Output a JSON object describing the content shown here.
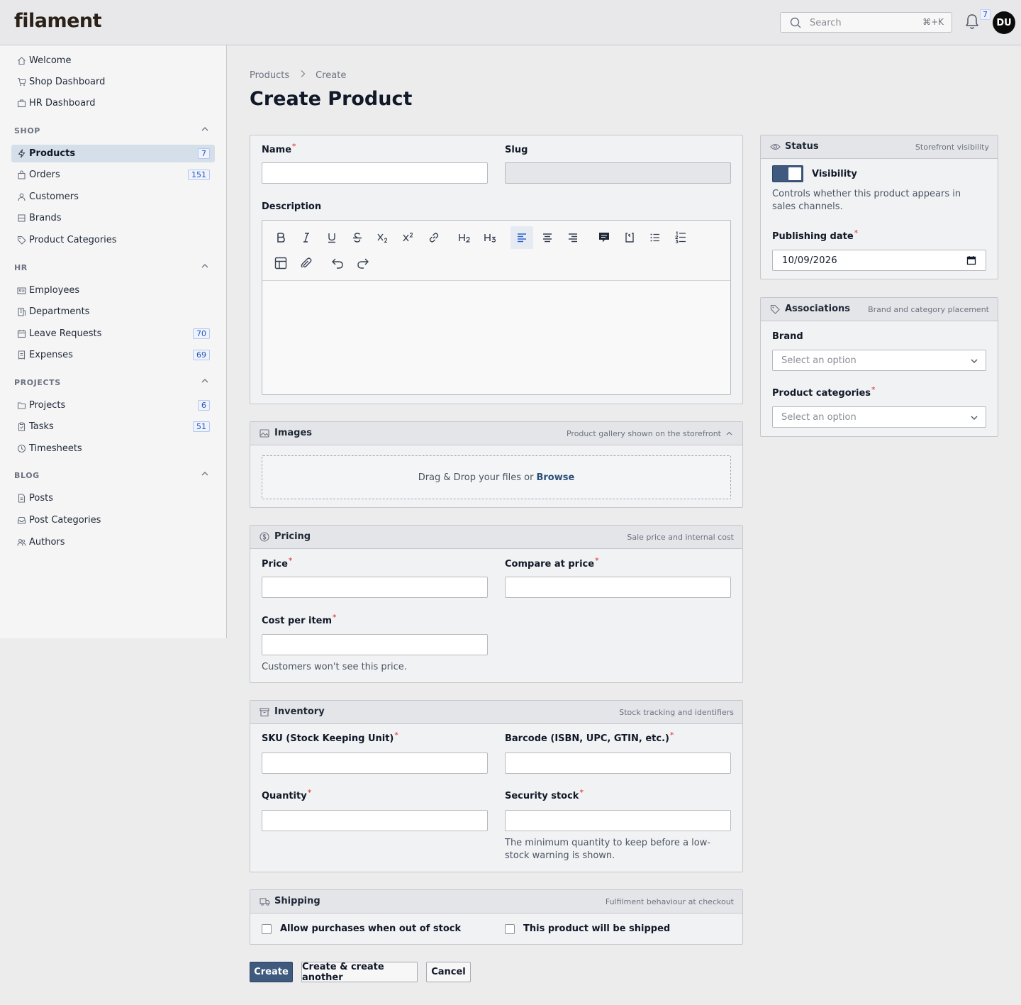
{
  "app": {
    "logo": "filament"
  },
  "topbar": {
    "search_placeholder": "Search",
    "search_shortcut": "⌘+K",
    "notifications_count": "7",
    "avatar_initials": "DU"
  },
  "sidebar": {
    "top_items": [
      {
        "label": "Welcome",
        "icon": "home-icon"
      },
      {
        "label": "Shop Dashboard",
        "icon": "cart-icon"
      },
      {
        "label": "HR Dashboard",
        "icon": "briefcase-icon"
      }
    ],
    "groups": [
      {
        "label": "SHOP",
        "items": [
          {
            "label": "Products",
            "badge": "7",
            "active": true,
            "icon": "bolt-icon"
          },
          {
            "label": "Orders",
            "badge": "151",
            "icon": "shopping-bag-icon"
          },
          {
            "label": "Customers",
            "icon": "users-icon"
          },
          {
            "label": "Brands",
            "icon": "cube-icon"
          },
          {
            "label": "Product Categories",
            "icon": "tag-icon"
          }
        ]
      },
      {
        "label": "HR",
        "items": [
          {
            "label": "Employees",
            "icon": "id-card-icon"
          },
          {
            "label": "Departments",
            "icon": "building-icon"
          },
          {
            "label": "Leave Requests",
            "badge": "70",
            "icon": "calendar-icon"
          },
          {
            "label": "Expenses",
            "badge": "69",
            "icon": "receipt-icon"
          }
        ]
      },
      {
        "label": "PROJECTS",
        "items": [
          {
            "label": "Projects",
            "badge": "6",
            "icon": "folder-icon"
          },
          {
            "label": "Tasks",
            "badge": "51",
            "icon": "clipboard-icon"
          },
          {
            "label": "Timesheets",
            "icon": "clock-icon"
          }
        ]
      },
      {
        "label": "BLOG",
        "items": [
          {
            "label": "Posts",
            "icon": "document-icon"
          },
          {
            "label": "Post Categories",
            "icon": "inbox-icon"
          },
          {
            "label": "Authors",
            "icon": "user-group-icon"
          }
        ]
      }
    ]
  },
  "breadcrumb": {
    "parent": "Products",
    "current": "Create"
  },
  "page_title": "Create Product",
  "main_form": {
    "name_label": "Name",
    "slug_label": "Slug",
    "description_label": "Description",
    "name_value": "",
    "slug_value": ""
  },
  "images": {
    "title": "Images",
    "description": "Product gallery shown on the storefront",
    "dropzone_text": "Drag & Drop your files or",
    "browse_label": "Browse"
  },
  "pricing": {
    "title": "Pricing",
    "description": "Sale price and internal cost",
    "price_label": "Price",
    "compare_label": "Compare at price",
    "cost_label": "Cost per item",
    "cost_hint": "Customers won't see this price."
  },
  "inventory": {
    "title": "Inventory",
    "description": "Stock tracking and identifiers",
    "sku_label": "SKU (Stock Keeping Unit)",
    "barcode_label": "Barcode (ISBN, UPC, GTIN, etc.)",
    "quantity_label": "Quantity",
    "security_label": "Security stock",
    "security_hint": "The minimum quantity to keep before a low-stock warning is shown."
  },
  "shipping": {
    "title": "Shipping",
    "description": "Fulfilment behaviour at checkout",
    "backorder_label": "Allow purchases when out of stock",
    "backorder_checked": false,
    "shipped_label": "This product will be shipped",
    "shipped_checked": false
  },
  "status": {
    "title": "Status",
    "description": "Storefront visibility",
    "visibility_label": "Visibility",
    "visibility_on": true,
    "visibility_hint": "Controls whether this product appears in sales channels.",
    "publishing_label": "Publishing date",
    "publishing_value": "10/09/2026"
  },
  "associations": {
    "title": "Associations",
    "description": "Brand and category placement",
    "brand_label": "Brand",
    "brand_placeholder": "Select an option",
    "categories_label": "Product categories",
    "categories_placeholder": "Select an option"
  },
  "actions": {
    "create": "Create",
    "create_another": "Create & create another",
    "cancel": "Cancel"
  },
  "colors": {
    "primary": "#3f5a7e",
    "required": "#dc2626",
    "badge": "#2455b5",
    "active_nav": "#d4dfe9"
  }
}
